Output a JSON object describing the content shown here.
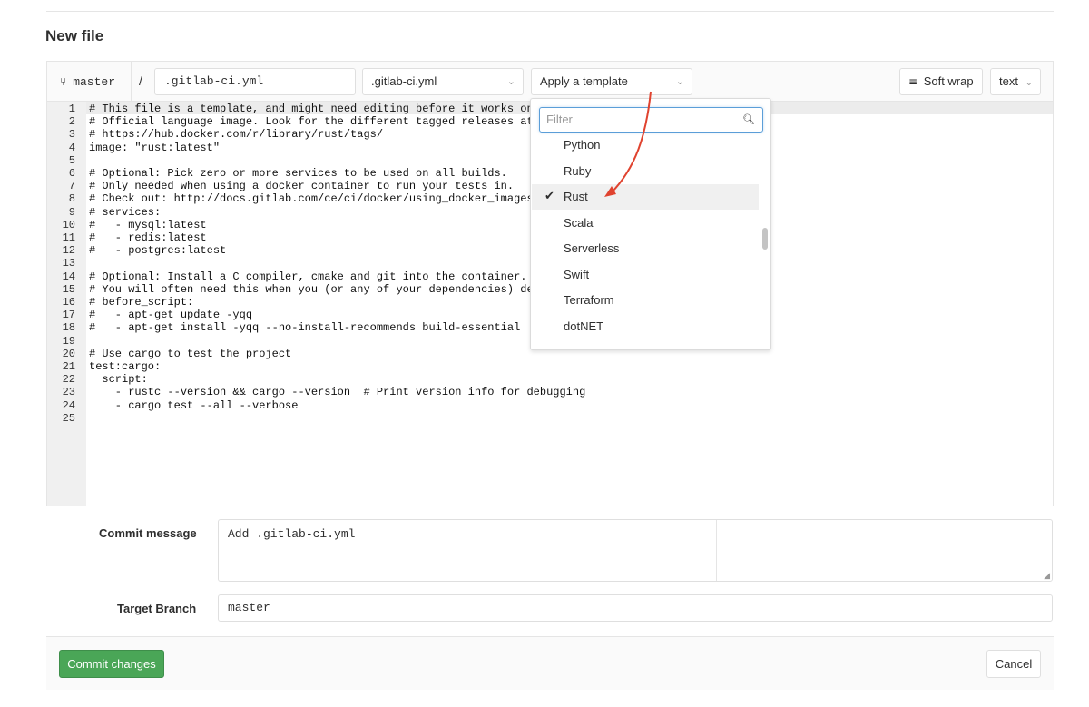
{
  "page": {
    "title": "New file"
  },
  "toolbar": {
    "branch": "master",
    "path_separator": "/",
    "filename": ".gitlab-ci.yml",
    "file_type": ".gitlab-ci.yml",
    "template_placeholder": "Apply a template",
    "soft_wrap_label": "Soft wrap",
    "mode": "text"
  },
  "editor": {
    "lines": [
      "# This file is a template, and might need editing before it works on your pr",
      "# Official language image. Look for the different tagged releases at:",
      "# https://hub.docker.com/r/library/rust/tags/",
      "image: \"rust:latest\"",
      "",
      "# Optional: Pick zero or more services to be used on all builds.",
      "# Only needed when using a docker container to run your tests in.",
      "# Check out: http://docs.gitlab.com/ce/ci/docker/using_docker_images.html#wh",
      "# services:",
      "#   - mysql:latest",
      "#   - redis:latest",
      "#   - postgres:latest",
      "",
      "# Optional: Install a C compiler, cmake and git into the container.",
      "# You will often need this when you (or any of your dependencies) depends on",
      "# before_script:",
      "#   - apt-get update -yqq",
      "#   - apt-get install -yqq --no-install-recommends build-essential",
      "",
      "# Use cargo to test the project",
      "test:cargo:",
      "  script:",
      "    - rustc --version && cargo --version  # Print version info for debugging",
      "    - cargo test --all --verbose",
      ""
    ]
  },
  "template_dropdown": {
    "filter_placeholder": "Filter",
    "items": [
      {
        "label": "Python",
        "selected": false
      },
      {
        "label": "Ruby",
        "selected": false
      },
      {
        "label": "Rust",
        "selected": true
      },
      {
        "label": "Scala",
        "selected": false
      },
      {
        "label": "Serverless",
        "selected": false
      },
      {
        "label": "Swift",
        "selected": false
      },
      {
        "label": "Terraform",
        "selected": false
      },
      {
        "label": "dotNET",
        "selected": false
      }
    ]
  },
  "form": {
    "commit_message_label": "Commit message",
    "commit_message_value": "Add .gitlab-ci.yml",
    "target_branch_label": "Target Branch",
    "target_branch_value": "master"
  },
  "actions": {
    "commit_label": "Commit changes",
    "cancel_label": "Cancel"
  },
  "colors": {
    "commit_button": "#4aa657",
    "annotation_arrow": "#e0432f",
    "filter_focus": "#5b9ed8"
  },
  "icons": {
    "branch": "fork-icon",
    "soft_wrap": "wrap-icon",
    "filter": "search-icon",
    "selected": "check-icon"
  }
}
